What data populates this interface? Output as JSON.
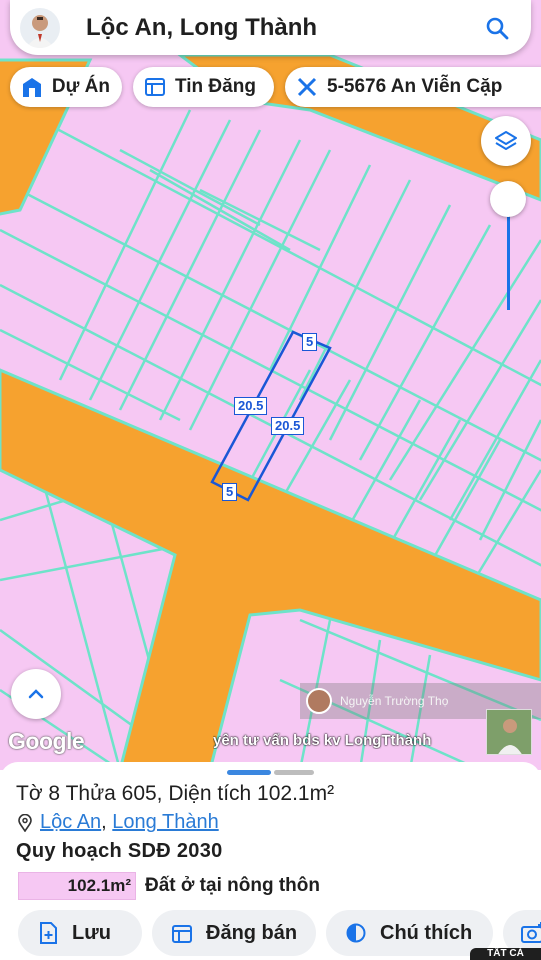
{
  "search": {
    "title": "Lộc An, Long Thành"
  },
  "chips": [
    {
      "label": "Dự Án",
      "icon": "building-icon"
    },
    {
      "label": "Tin Đăng",
      "icon": "listing-icon"
    },
    {
      "label": "5-5676 An Viễn Cặp",
      "icon": "ruler-icon"
    }
  ],
  "map": {
    "plot_dimensions": {
      "top": "5",
      "left": "20.5",
      "right": "20.5",
      "bottom": "5"
    },
    "attribution": "Google",
    "overlay_user": "Nguyễn Trường Thọ",
    "marquee_text": "yên tư vấn bds kv LongTthành",
    "colors": {
      "residential": "#f6c8f3",
      "road": "#f6a22f",
      "parcel_line": "#6ee3c9",
      "highlight": "#1a57d6"
    }
  },
  "sheet": {
    "parcel_title": "Tờ 8 Thửa 605, Diện tích 102.1m²",
    "location": {
      "commune": "Lộc An",
      "separator": ", ",
      "district": "Long Thành"
    },
    "plan_title": "Quy hoạch SDĐ 2030",
    "land_area": "102.1m²",
    "land_type": "Đất ở tại nông thôn",
    "actions": [
      {
        "label": "Lưu",
        "icon": "add-file-icon"
      },
      {
        "label": "Đăng bán",
        "icon": "calendar-icon"
      },
      {
        "label": "Chú thích",
        "icon": "contrast-icon"
      },
      {
        "label": "",
        "icon": "camera-add-icon"
      }
    ],
    "corner_tag": "TẤT CẢ"
  }
}
